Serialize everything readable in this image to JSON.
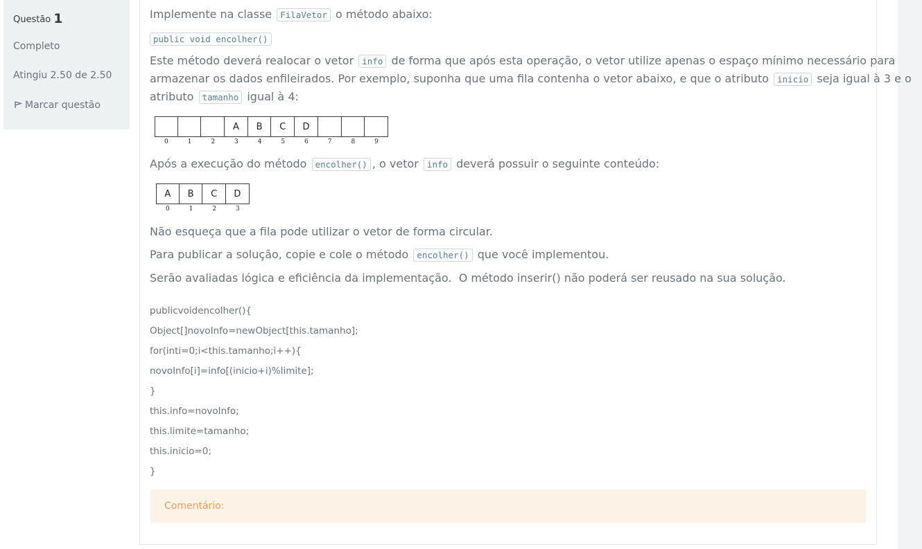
{
  "question_info": {
    "label": "Questão",
    "number": "1",
    "state": "Completo",
    "grade": "Atingiu 2.50 de 2.50",
    "flag_label": "Marcar questão"
  },
  "question": {
    "p1_before": "Implemente na classe",
    "p1_code": "FilaVetor",
    "p1_after": "o método abaixo:",
    "signature": "public void encolher()",
    "p2_a": "Este método deverá realocar o vetor",
    "p2_code1": "info",
    "p2_b": "de forma que após esta operação, o vetor utilize apenas o espaço mínimo necessário para",
    "p2_line2_a": "armazenar os dados enfileirados. Por exemplo, suponha que uma fila contenha o vetor abaixo, e que o atributo",
    "p2_code2": "inicio",
    "p2_line2_b": "seja igual à 3 e o",
    "p2_line3_a": "atributo",
    "p2_code3": "tamanho",
    "p2_line3_b": "igual à 4:",
    "p3_a": "Após a execução do método",
    "p3_code1": "encolher()",
    "p3_b": ", o vetor",
    "p3_code2": "info",
    "p3_c": "deverá possuir o seguinte conteúdo:",
    "p4": "Não esqueça que a fila pode utilizar o vetor de forma circular.",
    "p5_a": "Para publicar a solução, copie e cole o método",
    "p5_code": "encolher()",
    "p5_b": "que você implementou.",
    "p6": "Serão avaliadas lógica e eficiência da implementação.  O método inserir() não poderá ser reusado na sua solução."
  },
  "array_before": {
    "cells": [
      "",
      "",
      "",
      "A",
      "B",
      "C",
      "D",
      "",
      "",
      ""
    ],
    "indices": [
      "0",
      "1",
      "2",
      "3",
      "4",
      "5",
      "6",
      "7",
      "8",
      "9"
    ]
  },
  "array_after": {
    "cells": [
      "A",
      "B",
      "C",
      "D"
    ],
    "indices": [
      "0",
      "1",
      "2",
      "3"
    ]
  },
  "answer_lines": [
    "publicvoidencolher(){",
    "Object[]novoInfo=newObject[this.tamanho];",
    "for(inti=0;i<this.tamanho;i++){",
    "novoInfo[i]=info[(inicio+i)%limite];",
    "}",
    "this.info=novoInfo;",
    "this.limite=tamanho;",
    "this.inicio=0;",
    "}"
  ],
  "comment_label": "Comentário:"
}
